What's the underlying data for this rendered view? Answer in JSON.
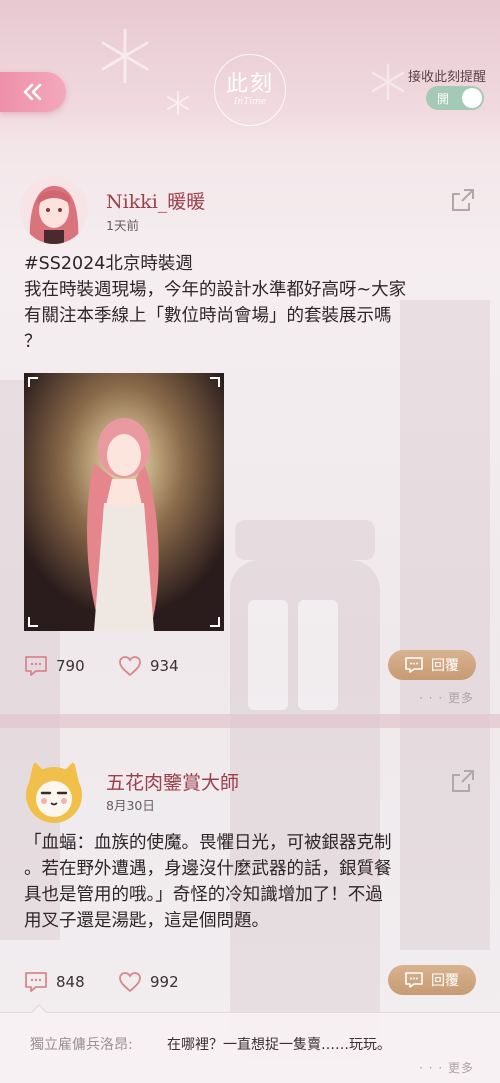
{
  "header": {
    "back_label": "«",
    "logo_main": "此刻",
    "logo_sub": "InTime",
    "notify_label": "接收此刻提醒",
    "toggle_label": "開"
  },
  "posts": [
    {
      "username": "Nikki_暖暖",
      "time": "1天前",
      "text_lines": [
        "#SS2024北京時裝週",
        "我在時裝週現場，今年的設計水準都好高呀~大家",
        "有關注本季線上「數位時尚會場」的套裝展示嗎",
        "？"
      ],
      "comments": "790",
      "likes": "934",
      "reply_label": "回覆",
      "more_label": "· · · 更多"
    },
    {
      "username": "五花肉鑒賞大師",
      "time": "8月30日",
      "text_lines": [
        "「血蝠：血族的使魔。畏懼日光，可被銀器克制",
        "。若在野外遭遇，身邊沒什麼武器的話，銀質餐",
        "具也是管用的哦。」奇怪的冷知識增加了！不過",
        "用叉子還是湯匙，這是個問題。"
      ],
      "comments": "848",
      "likes": "992",
      "reply_label": "回覆",
      "comment_author": "獨立雇傭兵洛昂:",
      "comment_text": "在哪裡？一直想捉一隻賣……玩玩。",
      "more_label": "· · · 更多"
    }
  ],
  "colors": {
    "accent_pink": "#ee8fa8",
    "username": "#9b3f4b",
    "reply_button": "#c79a73",
    "toggle_on": "#a4cab6"
  }
}
